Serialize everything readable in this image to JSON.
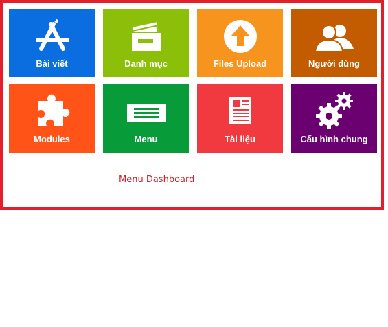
{
  "tiles": [
    {
      "label": "Bài viết",
      "icon": "app-store-icon",
      "color": "#0a6ee0"
    },
    {
      "label": "Danh mục",
      "icon": "folder-icon",
      "color": "#8cbf0a"
    },
    {
      "label": "Files Upload",
      "icon": "upload-icon",
      "color": "#f7941d"
    },
    {
      "label": "Người dùng",
      "icon": "users-icon",
      "color": "#c35b00"
    },
    {
      "label": "Modules",
      "icon": "puzzle-icon",
      "color": "#ff5317"
    },
    {
      "label": "Menu",
      "icon": "menu-card-icon",
      "color": "#079b3a"
    },
    {
      "label": "Tài liệu",
      "icon": "document-icon",
      "color": "#f03a3f"
    },
    {
      "label": "Cấu hình chung",
      "icon": "gears-icon",
      "color": "#6b0071"
    }
  ],
  "caption": "Menu Dashboard",
  "frame_color": "#e2202c"
}
